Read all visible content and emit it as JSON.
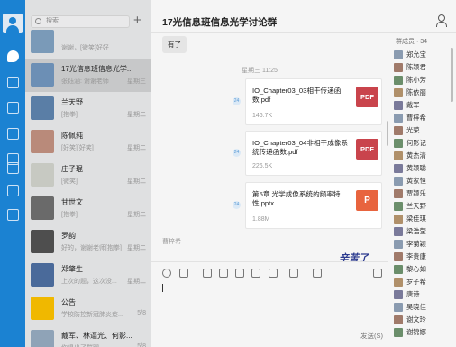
{
  "sidebar": {
    "icons": [
      "chat-icon",
      "organization-icon",
      "calendar-icon",
      "library-icon",
      "mail-icon",
      "word-icon",
      "hexagon-app-icon",
      "cloud-icon"
    ]
  },
  "chat_list": {
    "search_placeholder": "搜索",
    "add_label": "+",
    "items": [
      {
        "name": "",
        "preview": "谢谢，[微笑]好好",
        "time": "",
        "color": "#7a9ab8"
      },
      {
        "name": "17光信息班信息光学...",
        "preview": "张钰涵: 谢谢老师",
        "time": "星期三",
        "color": "#6c8fb5"
      },
      {
        "name": "兰天野",
        "preview": "[抱拳]",
        "time": "星期二",
        "color": "#5a7ea6"
      },
      {
        "name": "陈佩纯",
        "preview": "[好笑][好笑]",
        "time": "星期二",
        "color": "#b98a7a"
      },
      {
        "name": "庄子琨",
        "preview": "[微笑]",
        "time": "星期二",
        "color": "#c7c9c2"
      },
      {
        "name": "甘世文",
        "preview": "[抱拳]",
        "time": "星期二",
        "color": "#6a6a6a"
      },
      {
        "name": "罗韵",
        "preview": "好的，谢谢老师[抱拳]",
        "time": "星期二",
        "color": "#4e4e4e"
      },
      {
        "name": "郑肇生",
        "preview": "上次的题，这次没...",
        "time": "星期二",
        "color": "#4a6a9a"
      },
      {
        "name": "公告",
        "preview": "学校防控新冠肺炎疫...",
        "time": "5/8",
        "color": "#f0b800"
      },
      {
        "name": "戴军、林逼光、何影...",
        "preview": "你退出了群聊",
        "time": "5/8",
        "color": "#8fa3b7"
      }
    ]
  },
  "chat": {
    "title": "17光信息班信息光学讨论群",
    "top_bubble": "有了",
    "timestamp": "星期三 11:25",
    "files": [
      {
        "name": "IO_Chapter03_03相干传递函数.pdf",
        "size": "146.7K",
        "type": "PDF"
      },
      {
        "name": "IO_Chapter03_04非相干成像系统传递函数.pdf",
        "size": "226.5K",
        "type": "PDF"
      },
      {
        "name": "第5章 光学成像系统的频率特性.pptx",
        "size": "1.88M",
        "type": "P"
      }
    ],
    "read_mark": "24",
    "typing_user": "曹梓希",
    "handwriting": "辛苦了",
    "send_label": "发送(S)"
  },
  "members": {
    "header": "群成员 · 34",
    "list": [
      "郑允宝",
      "陈颖君",
      "陈小芳",
      "陈依丽",
      "戴军",
      "曹梓希",
      "光荣",
      "何影记",
      "黄杰清",
      "黄颖聪",
      "黄家恒",
      "贾颖乐",
      "兰天野",
      "梁佳琪",
      "梁浩莹",
      "李菊颖",
      "李贵康",
      "黎心如",
      "罗子希",
      "唐诗",
      "吴晓佳",
      "谢文玲",
      "谢锦娜"
    ]
  },
  "colors": {
    "accent": "#1b82d2",
    "pdf": "#c9444c",
    "ppt": "#e8643e"
  }
}
